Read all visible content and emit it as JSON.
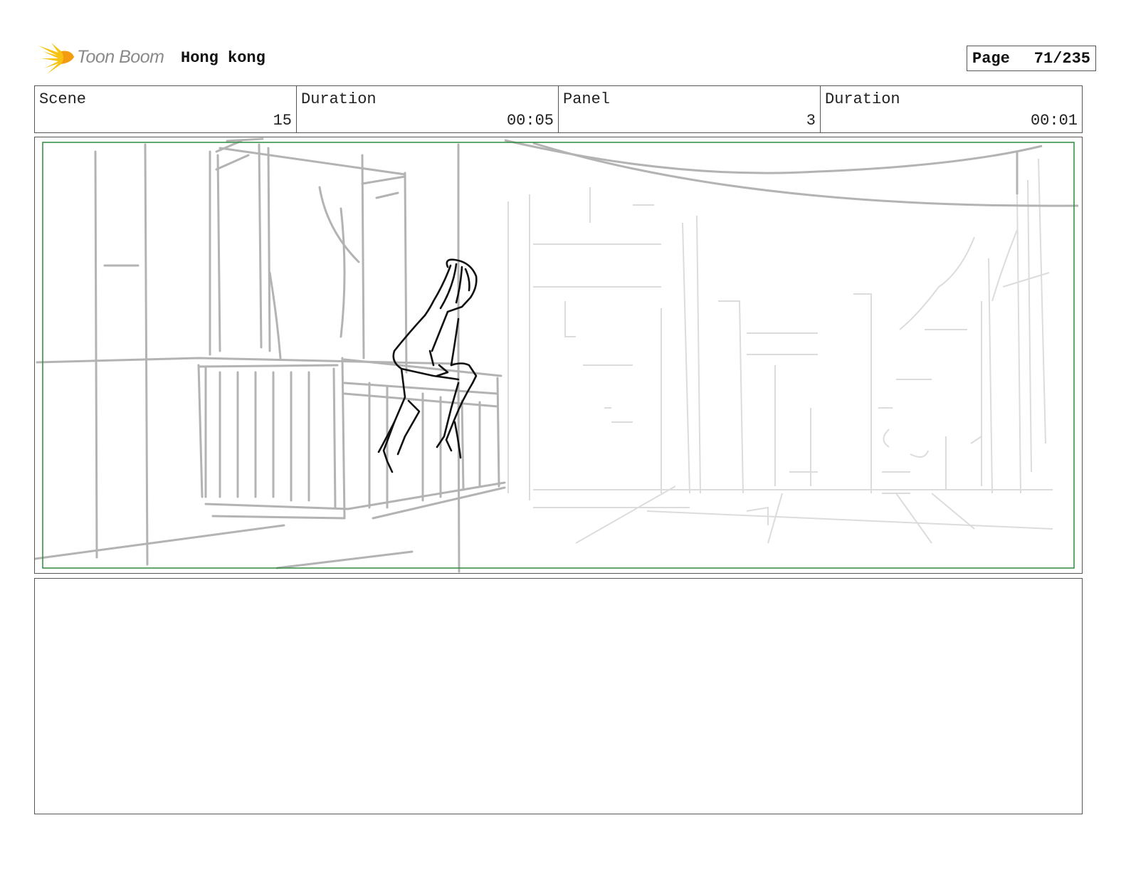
{
  "header": {
    "logo_icon": "toon-boom-star-icon",
    "logo_text": "Toon Boom",
    "project_title": "Hong kong",
    "page_label": "Page",
    "page_value": "71/235"
  },
  "info": {
    "scene_label": "Scene",
    "scene_value": "15",
    "scene_duration_label": "Duration",
    "scene_duration_value": "00:05",
    "panel_label": "Panel",
    "panel_value": "3",
    "panel_duration_label": "Duration",
    "panel_duration_value": "00:01"
  },
  "panel": {
    "image": "pencil-sketch-girl-sitting-on-balcony-railing-city-view",
    "safe_frame_color": "#2e8b3a"
  },
  "notes": {
    "text": ""
  }
}
